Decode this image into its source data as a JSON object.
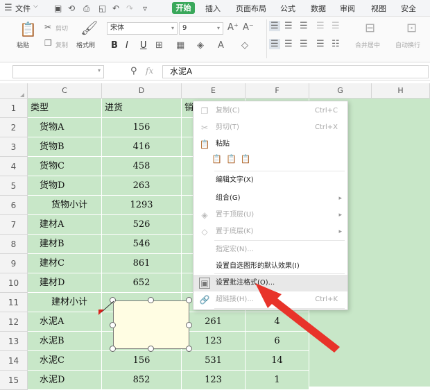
{
  "menubar": {
    "file_label": "文件",
    "tabs": [
      {
        "label": "开始",
        "active": true
      },
      {
        "label": "插入"
      },
      {
        "label": "页面布局"
      },
      {
        "label": "公式"
      },
      {
        "label": "数据"
      },
      {
        "label": "审阅"
      },
      {
        "label": "视图"
      },
      {
        "label": "安全"
      }
    ]
  },
  "ribbon": {
    "paste_label": "粘贴",
    "cut_label": "剪切",
    "copy_label": "复制",
    "format_painter_label": "格式刷",
    "font_name": "宋体",
    "font_size": "9",
    "merge_label": "合并居中",
    "wrap_label": "自动换行"
  },
  "formula_bar": {
    "fx_label": "fx",
    "value": "水泥A"
  },
  "columns": [
    "C",
    "D",
    "E",
    "F",
    "G",
    "H"
  ],
  "rows": [
    {
      "num": "1",
      "c": "类型",
      "d": "进货",
      "e": "销",
      "f": ""
    },
    {
      "num": "2",
      "c": "货物A",
      "d": "156",
      "e": "",
      "f": ""
    },
    {
      "num": "3",
      "c": "货物B",
      "d": "416",
      "e": "",
      "f": ""
    },
    {
      "num": "4",
      "c": "货物C",
      "d": "458",
      "e": "",
      "f": ""
    },
    {
      "num": "5",
      "c": "货物D",
      "d": "263",
      "e": "",
      "f": ""
    },
    {
      "num": "6",
      "c": "货物小计",
      "d": "1293",
      "e": "",
      "f": ""
    },
    {
      "num": "7",
      "c": "建材A",
      "d": "526",
      "e": "",
      "f": ""
    },
    {
      "num": "8",
      "c": "建材B",
      "d": "546",
      "e": "",
      "f": ""
    },
    {
      "num": "9",
      "c": "建材C",
      "d": "861",
      "e": "",
      "f": ""
    },
    {
      "num": "10",
      "c": "建材D",
      "d": "652",
      "e": "",
      "f": ""
    },
    {
      "num": "11",
      "c": "建材小计",
      "d": "",
      "e": "",
      "f": ""
    },
    {
      "num": "12",
      "c": "水泥A",
      "d": "",
      "e": "261",
      "f": "4"
    },
    {
      "num": "13",
      "c": "水泥B",
      "d": "",
      "e": "123",
      "f": "6"
    },
    {
      "num": "14",
      "c": "水泥C",
      "d": "156",
      "e": "531",
      "f": "14"
    },
    {
      "num": "15",
      "c": "水泥D",
      "d": "852",
      "e": "123",
      "f": "1"
    }
  ],
  "context_menu": {
    "items": [
      {
        "label": "复制(C)",
        "shortcut": "Ctrl+C",
        "disabled": true,
        "icon": "copy-icon"
      },
      {
        "label": "剪切(T)",
        "shortcut": "Ctrl+X",
        "disabled": true,
        "icon": "scissors-icon"
      },
      {
        "label": "粘贴",
        "shortcut": "",
        "disabled": false,
        "icon": "paste-icon"
      },
      {
        "label": "编辑文字(X)",
        "shortcut": "",
        "disabled": false,
        "icon": ""
      },
      {
        "label": "组合(G)",
        "shortcut": "",
        "disabled": false,
        "icon": "",
        "submenu": true
      },
      {
        "label": "置于顶层(U)",
        "shortcut": "",
        "disabled": true,
        "icon": "bring-front-icon",
        "submenu": true
      },
      {
        "label": "置于底层(K)",
        "shortcut": "",
        "disabled": true,
        "icon": "send-back-icon",
        "submenu": true
      },
      {
        "label": "指定宏(N)...",
        "shortcut": "",
        "disabled": true,
        "icon": ""
      },
      {
        "label": "设置自选图形的默认效果(I)",
        "shortcut": "",
        "disabled": false,
        "icon": ""
      },
      {
        "label": "设置批注格式(O)...",
        "shortcut": "",
        "disabled": false,
        "icon": "format-comment-icon",
        "highlighted": true
      },
      {
        "label": "超链接(H)...",
        "shortcut": "Ctrl+K",
        "disabled": true,
        "icon": "link-icon"
      }
    ]
  },
  "colors": {
    "accent": "#3aa85b",
    "cell_green": "#c8e7c8",
    "arrow_red": "#e8332a",
    "comment_bg": "#fffde3"
  }
}
